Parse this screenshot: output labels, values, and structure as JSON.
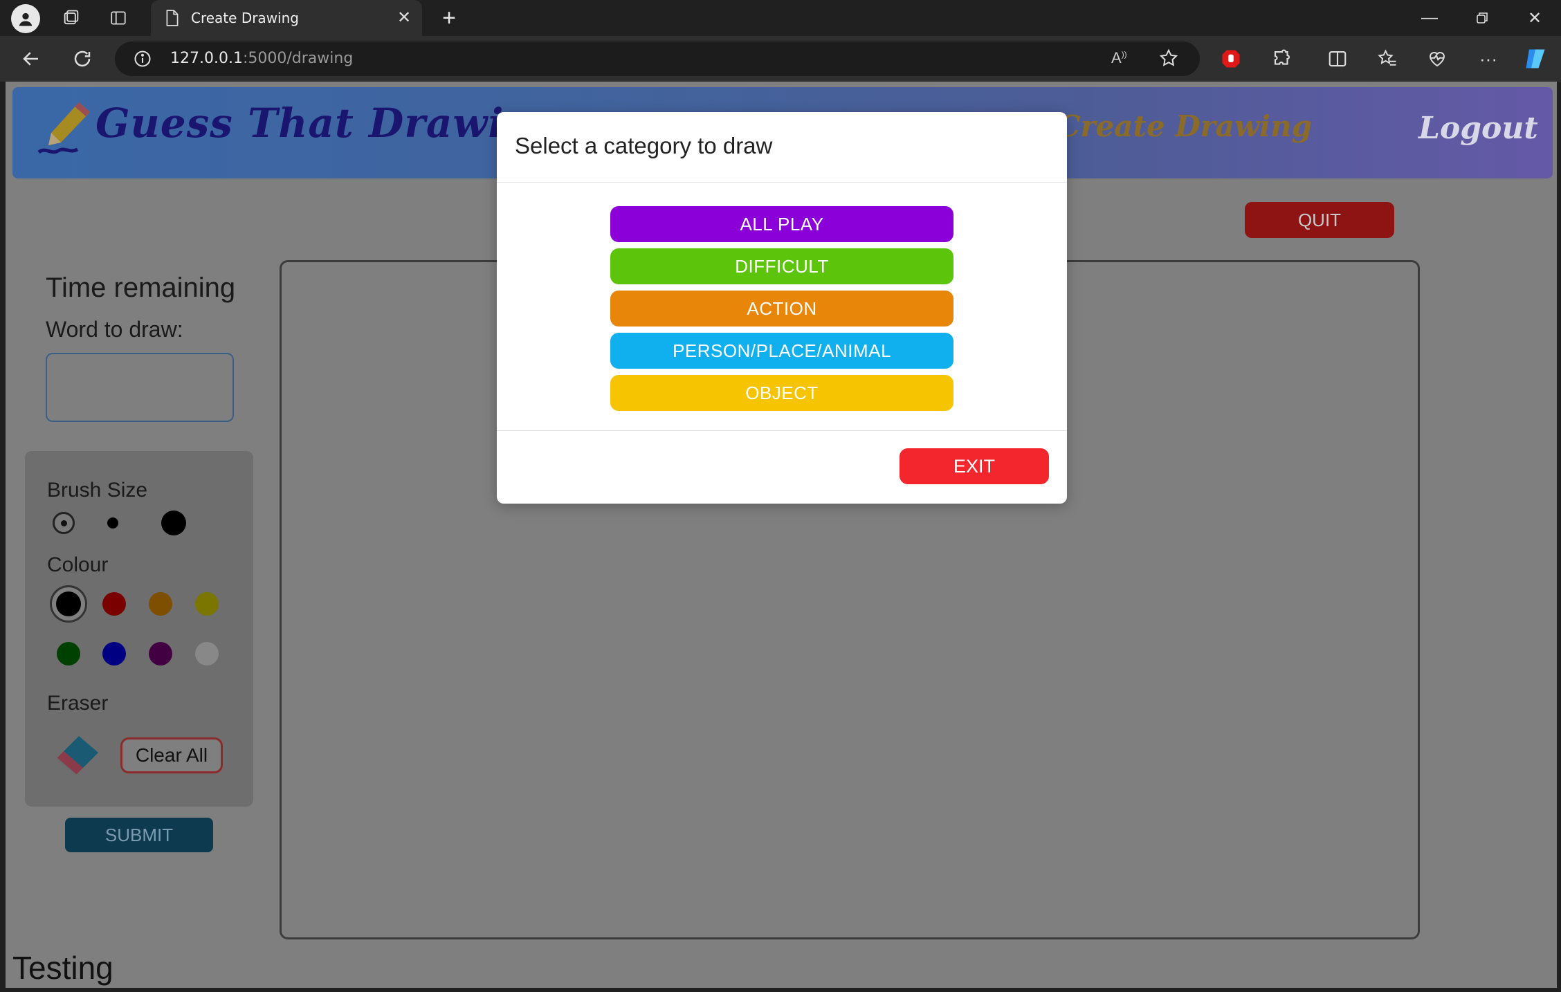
{
  "browser": {
    "tab_title": "Create Drawing",
    "url_host": "127.0.0.1",
    "url_path": ":5000/drawing"
  },
  "header": {
    "logo_text": "Guess That Drawing",
    "nav_create": "Create Drawing",
    "nav_logout": "Logout"
  },
  "game": {
    "quit_label": "QUIT",
    "time_label": "Time remaining",
    "word_label": "Word to draw:",
    "submit_label": "SUBMIT",
    "footer_text": "Testing"
  },
  "tools": {
    "brush_label": "Brush Size",
    "colour_label": "Colour",
    "eraser_label": "Eraser",
    "clear_label": "Clear All",
    "colours": [
      "#000000",
      "#cc0000",
      "#e08a00",
      "#e8e000",
      "#008000",
      "#0000ee",
      "#800080",
      "#ffffff"
    ]
  },
  "modal": {
    "title": "Select a category to draw",
    "categories": [
      {
        "label": "ALL PLAY",
        "color": "#8b00d8"
      },
      {
        "label": "DIFFICULT",
        "color": "#5cc40a"
      },
      {
        "label": "ACTION",
        "color": "#e8860a"
      },
      {
        "label": "PERSON/PLACE/ANIMAL",
        "color": "#10b0ef"
      },
      {
        "label": "OBJECT",
        "color": "#f6c400"
      }
    ],
    "exit_label": "EXIT"
  }
}
